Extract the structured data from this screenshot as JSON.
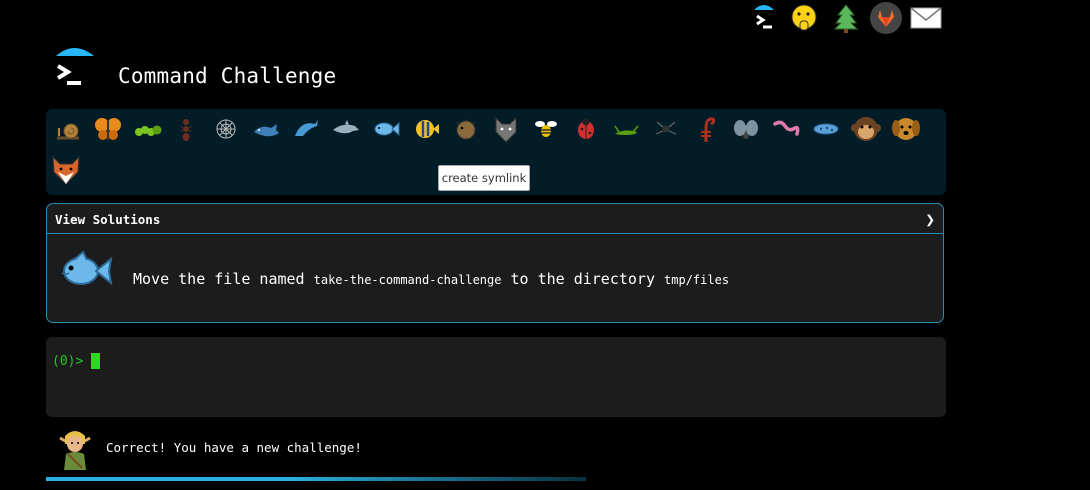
{
  "app": {
    "title": "Command Challenge"
  },
  "topnav": {
    "icons": [
      "terminal-logo-icon",
      "shushing-face-icon",
      "tree-icon",
      "gitlab-icon",
      "mail-icon"
    ]
  },
  "challenge_icons": [
    "snail",
    "butterfly",
    "caterpillar",
    "ant",
    "spider-web",
    "whale",
    "dolphin-blue",
    "dolphin-gray",
    "fish",
    "tropical-fish",
    "blowfish",
    "wolf",
    "bee",
    "ladybug",
    "cricket",
    "spider",
    "scorpion",
    "fly",
    "worm",
    "microbe",
    "monkey",
    "dog",
    "fox"
  ],
  "tooltip": {
    "text": "create symlink"
  },
  "solutions": {
    "header": "View Solutions",
    "chevron": "❯",
    "task": {
      "prefix": "Move the file named",
      "filename": "take-the-command-challenge",
      "middle": "to the directory",
      "directory": "tmp/files"
    }
  },
  "terminal": {
    "prompt": "(0)>"
  },
  "status": {
    "message": "Correct! You have a new challenge!"
  },
  "progress": {
    "fraction": 0.6
  },
  "colors": {
    "accent": "#2a8cb5",
    "prompt": "#22c722",
    "icon_bar_bg": "#021d27"
  }
}
